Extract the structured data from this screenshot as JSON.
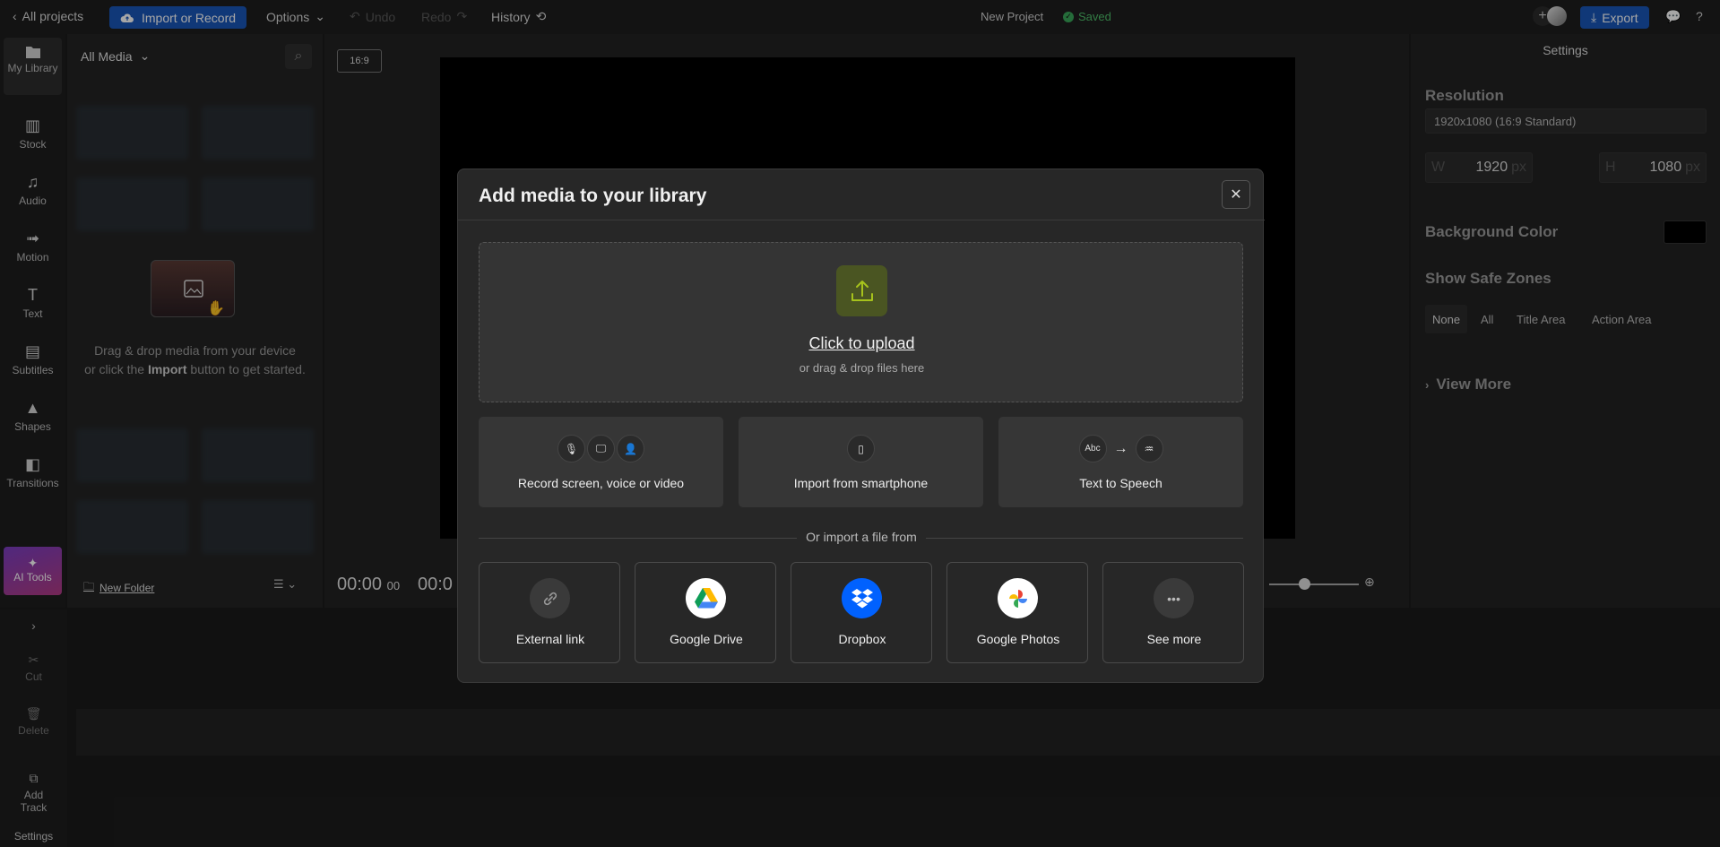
{
  "topbar": {
    "back_label": "All projects",
    "import_label": "Import or Record",
    "options_label": "Options",
    "undo_label": "Undo",
    "redo_label": "Redo",
    "history_label": "History",
    "project_name": "New Project",
    "saved_label": "Saved",
    "export_label": "Export"
  },
  "leftnav": {
    "items": [
      {
        "label": "My Library",
        "icon": "folder-icon"
      },
      {
        "label": "Stock",
        "icon": "books-icon"
      },
      {
        "label": "Audio",
        "icon": "music-note-icon"
      },
      {
        "label": "Motion",
        "icon": "motion-icon"
      },
      {
        "label": "Text",
        "icon": "text-icon"
      },
      {
        "label": "Subtitles",
        "icon": "subtitles-icon"
      },
      {
        "label": "Shapes",
        "icon": "shapes-icon"
      },
      {
        "label": "Transitions",
        "icon": "transitions-icon"
      }
    ],
    "ai_tools_label": "AI Tools"
  },
  "media_panel": {
    "filter_label": "All Media",
    "drop_line1": "Drag & drop media from your device",
    "drop_line2_a": "or click the ",
    "drop_line2_b": "Import",
    "drop_line2_c": " button to get started.",
    "new_folder_label": "New Folder"
  },
  "canvas": {
    "ratio": "16:9",
    "time_main": "00:00",
    "time_frames": "00",
    "time_end": "00:0"
  },
  "settings": {
    "title": "Settings",
    "resolution_label": "Resolution",
    "resolution_value": "1920x1080 (16:9 Standard)",
    "width_label": "W",
    "width_value": "1920",
    "height_label": "H",
    "height_value": "1080",
    "unit": "px",
    "bg_color_label": "Background Color",
    "bg_color": "#000000",
    "safe_zones_label": "Show Safe Zones",
    "safe_zone_options": [
      "None",
      "All",
      "Title Area",
      "Action Area"
    ],
    "safe_zone_selected": "None",
    "view_more_label": "View More"
  },
  "bottom_tools": {
    "cut_label": "Cut",
    "delete_label": "Delete",
    "add_track_label": "Add Track",
    "settings_label": "Settings"
  },
  "modal": {
    "title": "Add media to your library",
    "upload_title": "Click to upload",
    "upload_sub": "or drag & drop files here",
    "options": [
      {
        "label": "Record screen, voice or video"
      },
      {
        "label": "Import from smartphone"
      },
      {
        "label": "Text to Speech",
        "abc": "Abc"
      }
    ],
    "or_text": "Or import a file from",
    "sources": [
      {
        "label": "External link",
        "icon": "link-icon"
      },
      {
        "label": "Google Drive",
        "icon": "google-drive-icon"
      },
      {
        "label": "Dropbox",
        "icon": "dropbox-icon"
      },
      {
        "label": "Google Photos",
        "icon": "google-photos-icon"
      },
      {
        "label": "See more",
        "icon": "more-dots-icon"
      }
    ]
  },
  "colors": {
    "accent_blue": "#1a56b8",
    "upload_accent": "#a6c21c",
    "saved_green": "#4fbf6a",
    "dropbox_blue": "#0061fe"
  }
}
